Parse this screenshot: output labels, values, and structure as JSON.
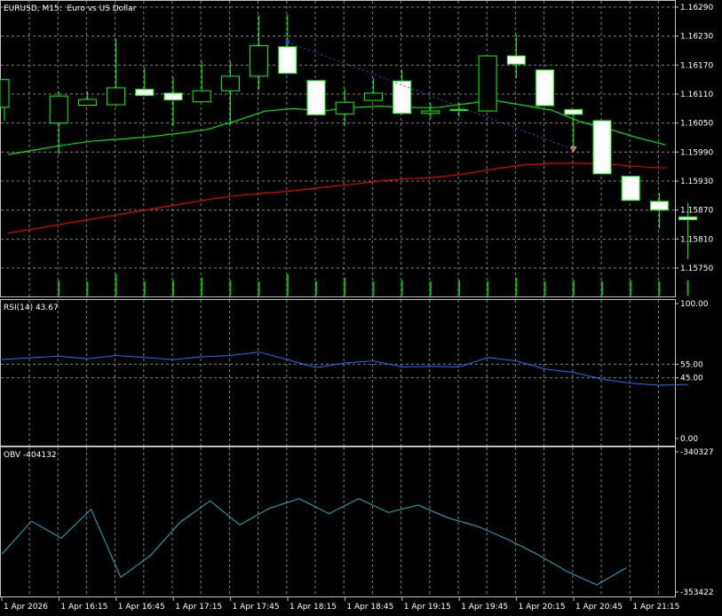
{
  "chart_data": [
    {
      "type": "candlestick",
      "title": "EURUSD, M15:  Euro vs US Dollar",
      "ylim": [
        1.1572,
        1.1632
      ],
      "y_ticks": [
        "1.16290",
        "1.16230",
        "1.16170",
        "1.16110",
        "1.16050",
        "1.15990",
        "1.15930",
        "1.15870",
        "1.15810",
        "1.15750"
      ],
      "x_ticks": [
        "1 Apr 2026",
        "1 Apr 16:15",
        "1 Apr 16:45",
        "1 Apr 17:15",
        "1 Apr 17:45",
        "1 Apr 18:15",
        "1 Apr 18:45",
        "1 Apr 19:15",
        "1 Apr 19:45",
        "1 Apr 20:15",
        "1 Apr 20:45",
        "1 Apr 21:15"
      ],
      "candles": [
        {
          "o": 1.16083,
          "h": 1.1612,
          "l": 1.16055,
          "c": 1.1614
        },
        {
          "o": 1.1605,
          "h": 1.16115,
          "l": 1.15985,
          "c": 1.16106
        },
        {
          "o": 1.16087,
          "h": 1.16115,
          "l": 1.16087,
          "c": 1.16099
        },
        {
          "o": 1.16088,
          "h": 1.16225,
          "l": 1.16085,
          "c": 1.16123
        },
        {
          "o": 1.1612,
          "h": 1.16165,
          "l": 1.16107,
          "c": 1.16107
        },
        {
          "o": 1.16112,
          "h": 1.16145,
          "l": 1.16045,
          "c": 1.16098
        },
        {
          "o": 1.16094,
          "h": 1.16178,
          "l": 1.16094,
          "c": 1.16117
        },
        {
          "o": 1.16117,
          "h": 1.16178,
          "l": 1.16047,
          "c": 1.16147
        },
        {
          "o": 1.16147,
          "h": 1.16273,
          "l": 1.16118,
          "c": 1.1621
        },
        {
          "o": 1.16208,
          "h": 1.16275,
          "l": 1.16153,
          "c": 1.16153
        },
        {
          "o": 1.16138,
          "h": 1.16138,
          "l": 1.16067,
          "c": 1.16067
        },
        {
          "o": 1.16069,
          "h": 1.16122,
          "l": 1.16045,
          "c": 1.16093
        },
        {
          "o": 1.16097,
          "h": 1.16143,
          "l": 1.16097,
          "c": 1.16112
        },
        {
          "o": 1.16137,
          "h": 1.16162,
          "l": 1.16068,
          "c": 1.1607
        },
        {
          "o": 1.1607,
          "h": 1.16092,
          "l": 1.16058,
          "c": 1.16075
        },
        {
          "o": 1.16078,
          "h": 1.16092,
          "l": 1.16063,
          "c": 1.16078
        },
        {
          "o": 1.16075,
          "h": 1.16189,
          "l": 1.16073,
          "c": 1.16189
        },
        {
          "o": 1.16189,
          "h": 1.16233,
          "l": 1.16143,
          "c": 1.16172
        },
        {
          "o": 1.1616,
          "h": 1.1616,
          "l": 1.16087,
          "c": 1.16086
        },
        {
          "o": 1.16078,
          "h": 1.16078,
          "l": 1.16,
          "c": 1.16068
        },
        {
          "o": 1.16055,
          "h": 1.16055,
          "l": 1.15945,
          "c": 1.15945
        },
        {
          "o": 1.1594,
          "h": 1.1594,
          "l": 1.1589,
          "c": 1.1589
        },
        {
          "o": 1.15888,
          "h": 1.15905,
          "l": 1.15832,
          "c": 1.1587
        },
        {
          "o": 1.15856,
          "h": 1.15885,
          "l": 1.15768,
          "c": 1.1585
        }
      ],
      "ma_fast": [
        1.15985,
        1.15995,
        1.16005,
        1.16013,
        1.16017,
        1.16022,
        1.16029,
        1.16037,
        1.16055,
        1.16075,
        1.1608,
        1.16075,
        1.16082,
        1.16085,
        1.16082,
        1.16082,
        1.1609,
        1.16097,
        1.16087,
        1.16077,
        1.16053,
        1.16038,
        1.1602,
        1.16005
      ],
      "ma_slow": [
        1.15822,
        1.15832,
        1.15842,
        1.15852,
        1.15862,
        1.15872,
        1.15882,
        1.15892,
        1.159,
        1.15905,
        1.1591,
        1.15917,
        1.15923,
        1.1593,
        1.15935,
        1.15938,
        1.15945,
        1.15955,
        1.15963,
        1.15967,
        1.15967,
        1.15965,
        1.1596,
        1.15957
      ],
      "trade_arrows": [
        {
          "candle": 9,
          "price": 1.16218,
          "color": "#1a4fd6"
        },
        {
          "candle": 19,
          "price": 1.15995,
          "color": "#e04020"
        }
      ],
      "colors": {
        "bull": "#ffffff",
        "bear": "#ffffff",
        "wick": "#00ff00",
        "ma_fast": "#00e000",
        "ma_slow": "#e00000",
        "volume": "#00c000",
        "grid": "#808080"
      }
    },
    {
      "type": "line",
      "title": "RSI(14) 43.67",
      "ylim": [
        0,
        100
      ],
      "y_ticks": [
        "100.00",
        "55.00",
        "45.00",
        "0.00"
      ],
      "levels": [
        55,
        45
      ],
      "values": [
        58.5,
        61,
        59,
        61.5,
        60,
        58.5,
        60.5,
        61.5,
        64,
        58.5,
        52.5,
        56,
        57.5,
        53,
        53.5,
        53,
        60,
        57.5,
        51.5,
        49,
        44,
        41,
        39.5,
        40
      ],
      "color": "#1e6fff"
    },
    {
      "type": "line",
      "title": "OBV -404132",
      "y_ticks": [
        "-340327",
        "-353422"
      ],
      "values": [
        -349900,
        -346800,
        -348400,
        -345700,
        -352050,
        -350000,
        -346900,
        -344900,
        -347150,
        -345600,
        -344700,
        -346100,
        -344700,
        -346000,
        -345300,
        -346500,
        -347300,
        -348500,
        -349900,
        -351500,
        -352750,
        -351150
      ],
      "color": "#20b2c8"
    }
  ]
}
